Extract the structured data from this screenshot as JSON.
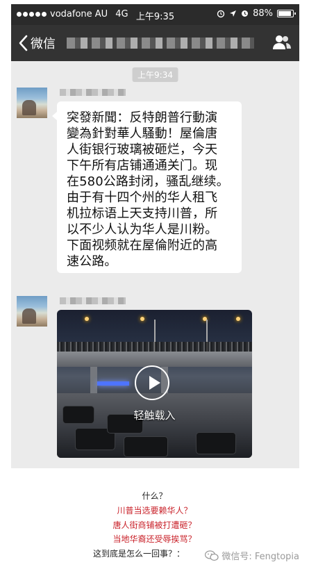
{
  "status_bar": {
    "carrier": "vodafone AU",
    "network": "4G",
    "time": "上午9:35",
    "battery": "88%",
    "battery_level": 0.88
  },
  "nav": {
    "back_label": "微信"
  },
  "chat": {
    "timestamp": "上午9:34",
    "message_lines": [
      "突發新聞：反特朗普行動演",
      "變為針對華人騷動！屋倫唐",
      "人街银行玻璃被砸烂，今天",
      "下午所有店铺通通关门。现",
      "在580公路封闭，骚乱继续。",
      "由于有十四个州的华人租飞",
      "机拉标语上天支持川普，所",
      "以不少人认为华人是川粉。",
      "下面视频就在屋倫附近的高",
      "速公路。"
    ],
    "video_label": "轻触载入"
  },
  "caption": {
    "line1": "什么？",
    "line2": "川普当选要赖华人？",
    "line3": "唐人街商铺被打遭砸？",
    "line4": "当地华裔还受辱挨骂？",
    "line5": "这到底是怎么一回事？："
  },
  "watermark": {
    "text": "微信号: Fengtopia"
  },
  "icons": {
    "signal": "signal-dots-icon",
    "alarm": "alarm-icon",
    "location": "location-arrow-icon",
    "clock": "clock-icon",
    "back": "chevron-left-icon",
    "contact": "contact-info-icon",
    "play": "play-icon",
    "wechat": "wechat-logo-icon"
  },
  "colors": {
    "caption_red": "#c9222a",
    "nav_bar": "#333333",
    "chat_bg": "#ebebeb"
  }
}
